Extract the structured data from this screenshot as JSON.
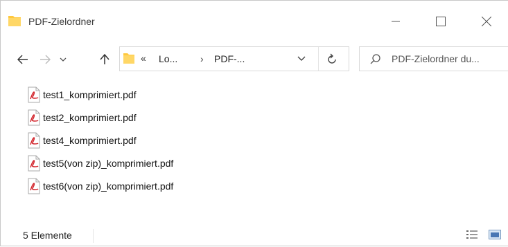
{
  "window": {
    "title": "PDF-Zielordner",
    "accent": "#ffc83d"
  },
  "address": {
    "overflow": "«",
    "segment1": "Lo...",
    "separator": "›",
    "segment2": "PDF-..."
  },
  "search": {
    "placeholder": "PDF-Zielordner du..."
  },
  "files": [
    {
      "name": "test1_komprimiert.pdf",
      "icon": "pdf-icon"
    },
    {
      "name": "test2_komprimiert.pdf",
      "icon": "pdf-icon"
    },
    {
      "name": "test4_komprimiert.pdf",
      "icon": "pdf-icon"
    },
    {
      "name": "test5(von zip)_komprimiert.pdf",
      "icon": "pdf-icon"
    },
    {
      "name": "test6(von zip)_komprimiert.pdf",
      "icon": "pdf-icon"
    }
  ],
  "status": {
    "count_text": "5 Elemente"
  }
}
